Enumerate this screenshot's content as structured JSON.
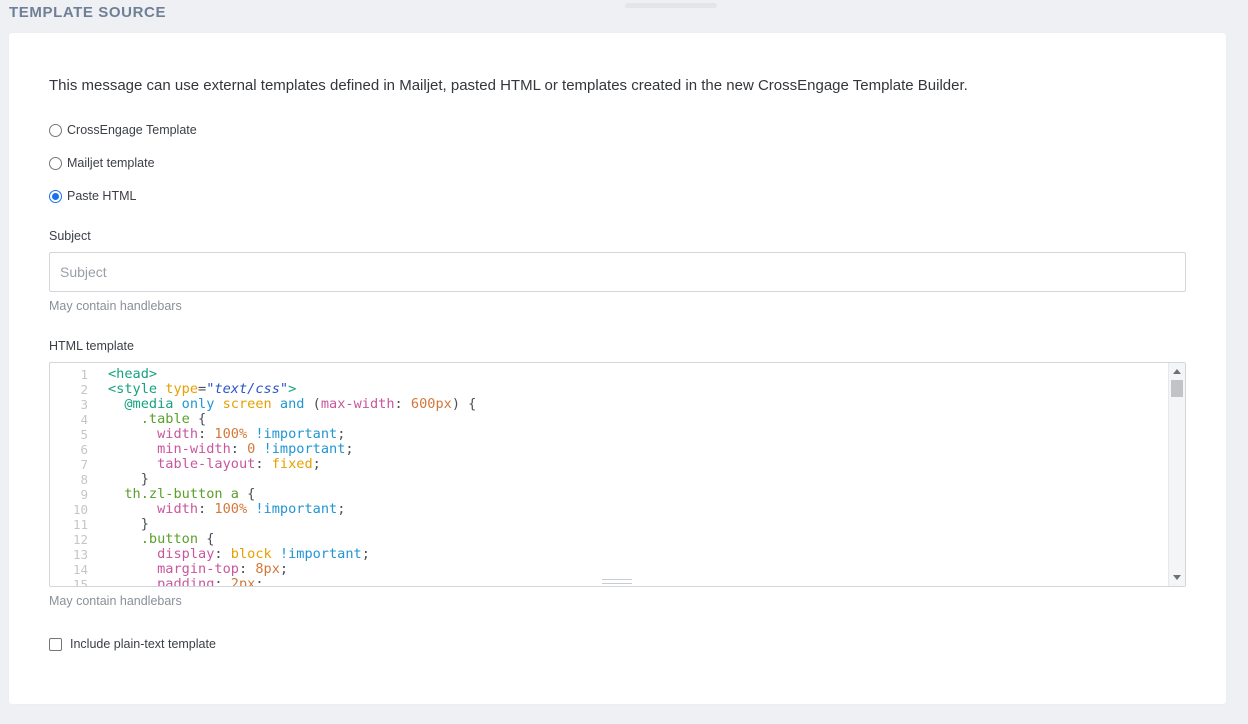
{
  "section": {
    "title": "TEMPLATE SOURCE"
  },
  "intro": "This message can use external templates defined in Mailjet, pasted HTML or templates created in the new CrossEngage Template Builder.",
  "source_options": [
    {
      "label": "CrossEngage Template",
      "checked": false
    },
    {
      "label": "Mailjet template",
      "checked": false
    },
    {
      "label": "Paste HTML",
      "checked": true
    }
  ],
  "subject": {
    "label": "Subject",
    "placeholder": "Subject",
    "value": "",
    "hint": "May contain handlebars"
  },
  "html_template": {
    "label": "HTML template",
    "hint": "May contain handlebars",
    "line_numbers": [
      "1",
      "2",
      "3",
      "4",
      "5",
      "6",
      "7",
      "8",
      "9",
      "10",
      "11",
      "12",
      "13",
      "14",
      "15"
    ]
  },
  "plain_text": {
    "label": "Include plain-text template",
    "checked": false
  },
  "colors": {
    "accent": "#1a73e8",
    "section_title": "#6f7f96",
    "background": "#eef0f4"
  }
}
